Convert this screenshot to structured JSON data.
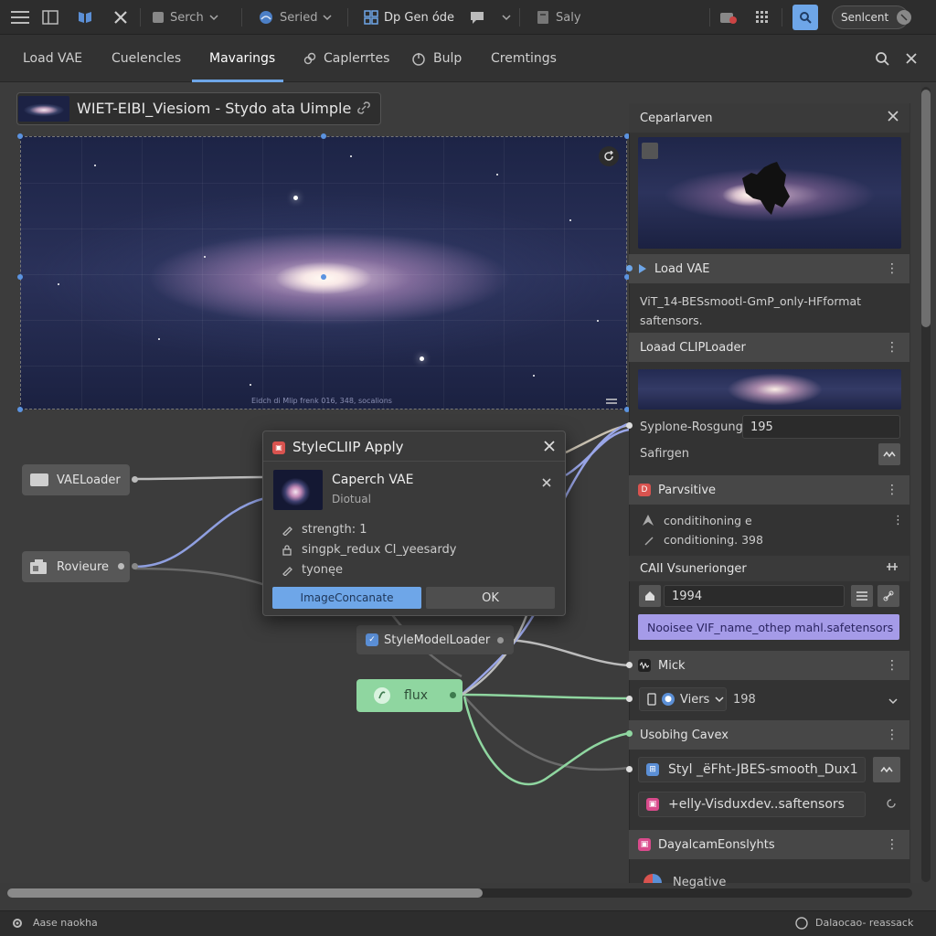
{
  "toolbar": {
    "search_label": "Serch",
    "served_label": "Seried",
    "op_label": "Dp Gen óde",
    "save_label": "Saly",
    "status_label": "Senlcent"
  },
  "tabs": [
    {
      "label": "Load VAE"
    },
    {
      "label": "Cuelencles"
    },
    {
      "label": "Mavarings"
    },
    {
      "label": "Caplerrtes"
    },
    {
      "label": "Bulp"
    },
    {
      "label": "Cremtings"
    }
  ],
  "image_node": {
    "title": "WIET-EIBI_Viesiom - Stydo ata Uimple",
    "caption": "Eidch di Mlip frenk 016, 348, socalions"
  },
  "nodes": {
    "vae_loader": "VAELoader",
    "preview": "Rovieure",
    "style_model_loader": "StyleModelLoader",
    "flux": "flux"
  },
  "dialog": {
    "title": "StyleCLIIP Apply",
    "item_title": "Caperch VAE",
    "item_sub": "Diotual",
    "rows": [
      "strength:  1",
      "singpk_redux  CI_yeesardy",
      "tyonęe"
    ],
    "btn_primary": "ImageConcanate",
    "btn_ok": "OK"
  },
  "panel": {
    "header": "Ceparlarven",
    "load_vae": "Load VAE",
    "vae_file": "ViT_14-BESsmootl-GmP_only-HFformat saftensors.",
    "clip_loader": "Loaad CLIPLoader",
    "field1_label": "Syplone-Rosgung:",
    "field1_value": "195",
    "field2_label": "Safirgen",
    "positive": "Parvsitive",
    "cond1": "conditihoning  e",
    "cond2": "conditioning. 398",
    "cati": "CAII Vsunerionger",
    "num_value": "1994",
    "purple_field": "Nooisee VIF_name_othep mahl.safetensors",
    "mick": "Mick",
    "viers": "Viers",
    "viers_value": "198",
    "usobihg": "Usobihg Cavex",
    "styl_field": "Styl _ëFht-JBES-smooth_Dux1",
    "telly_field": "+elly-Visduxdev..saftensors",
    "dayal": "DayalcamEonslyhts",
    "negative": "Negative"
  },
  "statusbar": {
    "left": "Aase naokha",
    "right": "Dalaocao- reassack"
  }
}
